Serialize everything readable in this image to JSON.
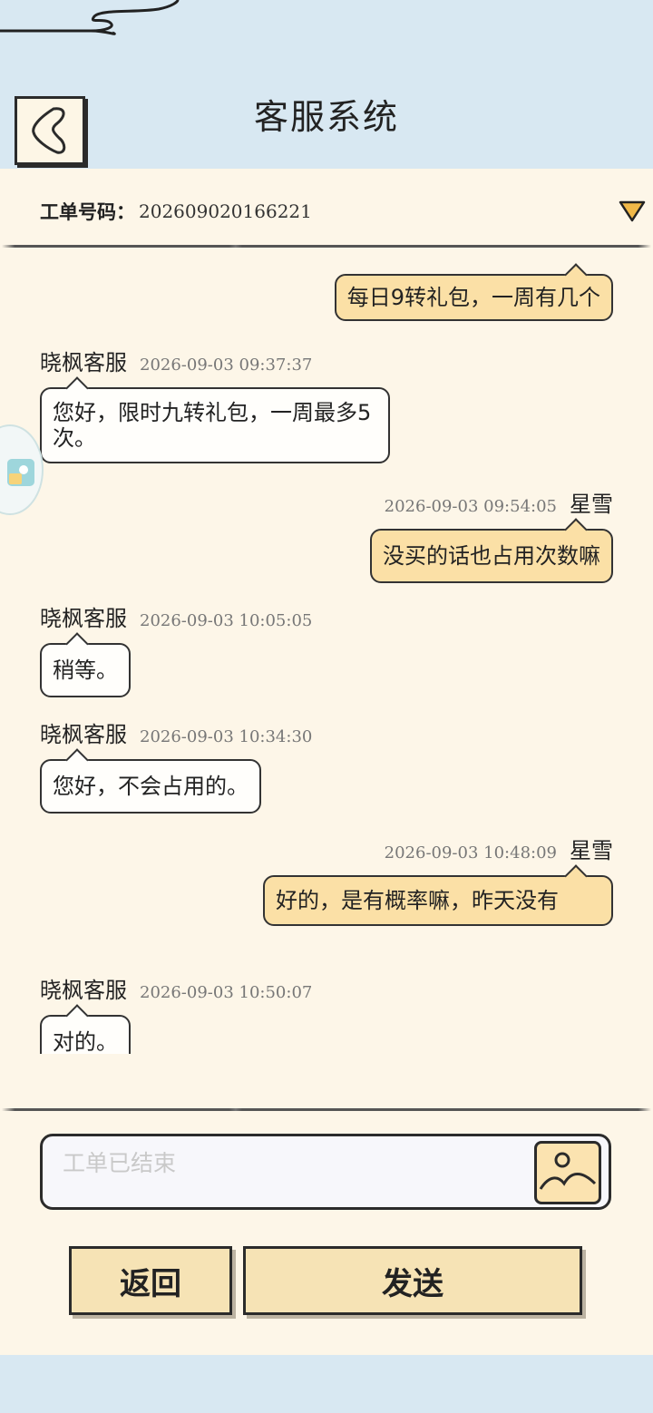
{
  "header": {
    "title": "客服系统",
    "back_icon": "chevron-left-icon"
  },
  "ticket": {
    "label": "工单号码：",
    "number": "202609020166221",
    "dropdown_icon": "triangle-down-icon"
  },
  "messages": [
    {
      "side": "right",
      "name": "",
      "time": "",
      "text": "每日9转礼包，一周有几个"
    },
    {
      "side": "left",
      "name": "晓枫客服",
      "time": "2026-09-03 09:37:37",
      "text": "您好，限时九转礼包，一周最多5次。"
    },
    {
      "side": "right",
      "name": "星雪",
      "time": "2026-09-03 09:54:05",
      "text": "没买的话也占用次数嘛"
    },
    {
      "side": "left",
      "name": "晓枫客服",
      "time": "2026-09-03 10:05:05",
      "text": "稍等。"
    },
    {
      "side": "left",
      "name": "晓枫客服",
      "time": "2026-09-03 10:34:30",
      "text": "您好，不会占用的。"
    },
    {
      "side": "right",
      "name": "星雪",
      "time": "2026-09-03 10:48:09",
      "text": "好的，是有概率嘛，昨天没有"
    },
    {
      "side": "left",
      "name": "晓枫客服",
      "time": "2026-09-03 10:50:07",
      "text": "对的。"
    }
  ],
  "input": {
    "placeholder": "工单已结束",
    "image_icon": "image-upload-icon"
  },
  "buttons": {
    "back": "返回",
    "send": "发送"
  },
  "colors": {
    "sky": "#d8e8f2",
    "panel": "#fdf6e8",
    "bubble_self": "#fbe0a6",
    "bubble_agent": "#fffefb",
    "accent": "#f0b848"
  }
}
